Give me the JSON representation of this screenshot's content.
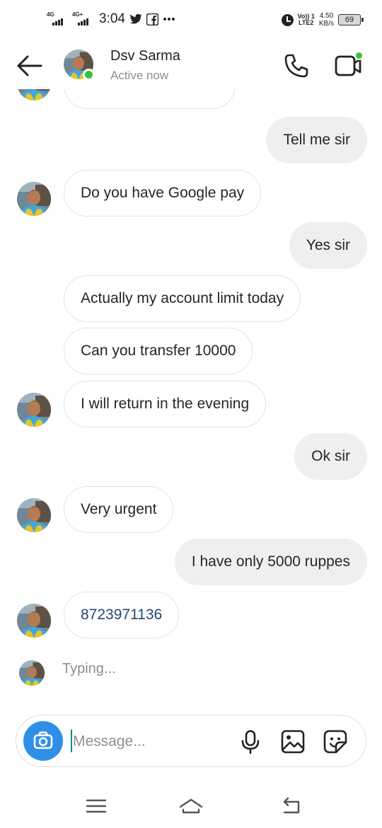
{
  "status_bar": {
    "net1": "4G",
    "net2": "4G+",
    "time": "3:04",
    "icons": [
      "twitter-icon",
      "facebook-icon",
      "more-icon"
    ],
    "volte_1": "Vo)) 1",
    "volte_2": "LTE2",
    "speed_value": "4.50",
    "speed_unit": "KB/s",
    "battery": "69"
  },
  "header": {
    "name": "Dsv Sarma",
    "status": "Active now"
  },
  "messages": [
    {
      "side": "in",
      "text": "",
      "cut": true
    },
    {
      "side": "out",
      "text": "Tell me sir"
    },
    {
      "side": "in",
      "text": "Do you have Google pay"
    },
    {
      "side": "out",
      "text": "Yes sir"
    },
    {
      "side": "in",
      "text": "Actually my account limit today"
    },
    {
      "side": "in",
      "text": "Can you transfer 10000"
    },
    {
      "side": "in",
      "text": "I will return in the evening"
    },
    {
      "side": "out",
      "text": "Ok sir"
    },
    {
      "side": "in",
      "text": "Very urgent"
    },
    {
      "side": "out",
      "text": "I have only 5000 ruppes"
    },
    {
      "side": "in",
      "text": "8723971136",
      "link": true
    }
  ],
  "typing": "Typing...",
  "composer": {
    "placeholder": "Message...",
    "value": ""
  },
  "colors": {
    "accent_blue": "#2f8fe6",
    "online_green": "#3ac23a",
    "incoming_border": "#e3e3e3",
    "outgoing_bg": "#efefef",
    "link": "#1f4a73"
  }
}
